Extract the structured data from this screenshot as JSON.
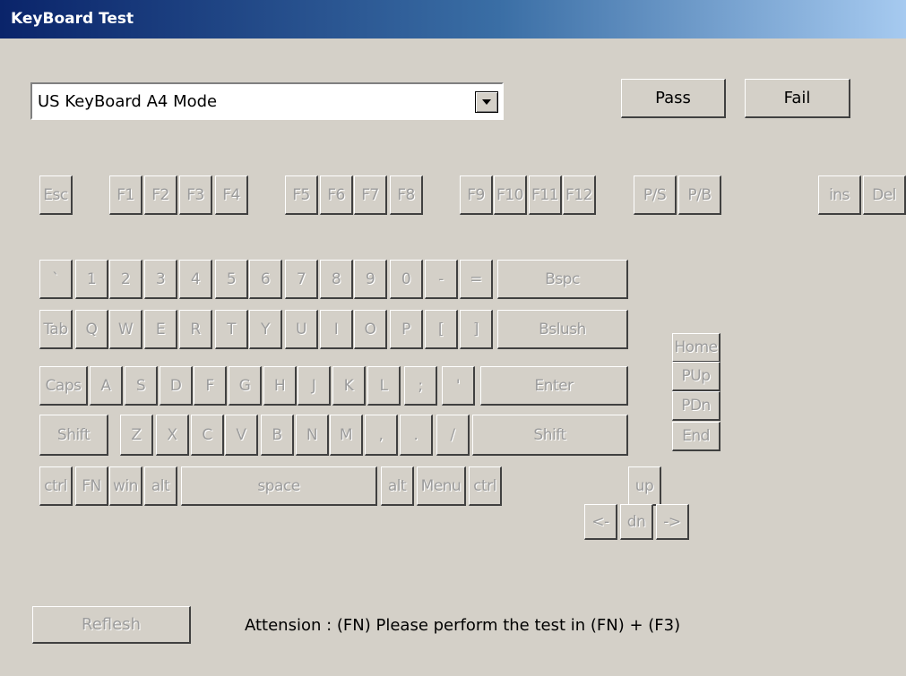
{
  "window": {
    "title": "KeyBoard Test"
  },
  "layout_select": {
    "value": "US KeyBoard A4 Mode"
  },
  "buttons": {
    "pass": "Pass",
    "fail": "Fail",
    "refresh": "Reflesh"
  },
  "attention": "Attension : (FN) Please perform the test in (FN) + (F3)",
  "keys": [
    {
      "id": "esc",
      "label": "Esc"
    },
    {
      "id": "f1",
      "label": "F1"
    },
    {
      "id": "f2",
      "label": "F2"
    },
    {
      "id": "f3",
      "label": "F3"
    },
    {
      "id": "f4",
      "label": "F4"
    },
    {
      "id": "f5",
      "label": "F5"
    },
    {
      "id": "f6",
      "label": "F6"
    },
    {
      "id": "f7",
      "label": "F7"
    },
    {
      "id": "f8",
      "label": "F8"
    },
    {
      "id": "f9",
      "label": "F9"
    },
    {
      "id": "f10",
      "label": "F10"
    },
    {
      "id": "f11",
      "label": "F11"
    },
    {
      "id": "f12",
      "label": "F12"
    },
    {
      "id": "ps",
      "label": "P/S"
    },
    {
      "id": "pb",
      "label": "P/B"
    },
    {
      "id": "ins",
      "label": "ins"
    },
    {
      "id": "del",
      "label": "Del"
    },
    {
      "id": "backtick",
      "label": "`"
    },
    {
      "id": "1",
      "label": "1"
    },
    {
      "id": "2",
      "label": "2"
    },
    {
      "id": "3",
      "label": "3"
    },
    {
      "id": "4",
      "label": "4"
    },
    {
      "id": "5",
      "label": "5"
    },
    {
      "id": "6",
      "label": "6"
    },
    {
      "id": "7",
      "label": "7"
    },
    {
      "id": "8",
      "label": "8"
    },
    {
      "id": "9",
      "label": "9"
    },
    {
      "id": "0",
      "label": "0"
    },
    {
      "id": "minus",
      "label": "-"
    },
    {
      "id": "equal",
      "label": "="
    },
    {
      "id": "bspc",
      "label": "Bspc"
    },
    {
      "id": "tab",
      "label": "Tab"
    },
    {
      "id": "q",
      "label": "Q"
    },
    {
      "id": "w",
      "label": "W"
    },
    {
      "id": "e",
      "label": "E"
    },
    {
      "id": "r",
      "label": "R"
    },
    {
      "id": "t",
      "label": "T"
    },
    {
      "id": "y",
      "label": "Y"
    },
    {
      "id": "u",
      "label": "U"
    },
    {
      "id": "i",
      "label": "I"
    },
    {
      "id": "o",
      "label": "O"
    },
    {
      "id": "p",
      "label": "P"
    },
    {
      "id": "lbracket",
      "label": "["
    },
    {
      "id": "rbracket",
      "label": "]"
    },
    {
      "id": "bslush",
      "label": "Bslush"
    },
    {
      "id": "caps",
      "label": "Caps"
    },
    {
      "id": "a",
      "label": "A"
    },
    {
      "id": "s",
      "label": "S"
    },
    {
      "id": "d",
      "label": "D"
    },
    {
      "id": "f",
      "label": "F"
    },
    {
      "id": "g",
      "label": "G"
    },
    {
      "id": "h",
      "label": "H"
    },
    {
      "id": "j",
      "label": "J"
    },
    {
      "id": "k",
      "label": "K"
    },
    {
      "id": "l",
      "label": "L"
    },
    {
      "id": "semicolon",
      "label": ";"
    },
    {
      "id": "quote",
      "label": "'"
    },
    {
      "id": "enter",
      "label": "Enter"
    },
    {
      "id": "lshift",
      "label": "Shift"
    },
    {
      "id": "z",
      "label": "Z"
    },
    {
      "id": "x",
      "label": "X"
    },
    {
      "id": "c",
      "label": "C"
    },
    {
      "id": "v",
      "label": "V"
    },
    {
      "id": "b",
      "label": "B"
    },
    {
      "id": "n",
      "label": "N"
    },
    {
      "id": "m",
      "label": "M"
    },
    {
      "id": "comma",
      "label": ","
    },
    {
      "id": "period",
      "label": "."
    },
    {
      "id": "slash",
      "label": "/"
    },
    {
      "id": "rshift",
      "label": "Shift"
    },
    {
      "id": "lctrl",
      "label": "ctrl"
    },
    {
      "id": "fn",
      "label": "FN"
    },
    {
      "id": "win",
      "label": "win"
    },
    {
      "id": "lalt",
      "label": "alt"
    },
    {
      "id": "space",
      "label": "space"
    },
    {
      "id": "ralt",
      "label": "alt"
    },
    {
      "id": "menu",
      "label": "Menu"
    },
    {
      "id": "rctrl",
      "label": "ctrl"
    },
    {
      "id": "home",
      "label": "Home"
    },
    {
      "id": "pup",
      "label": "PUp"
    },
    {
      "id": "pdn",
      "label": "PDn"
    },
    {
      "id": "end",
      "label": "End"
    },
    {
      "id": "up",
      "label": "up"
    },
    {
      "id": "left",
      "label": "<-"
    },
    {
      "id": "down",
      "label": "dn"
    },
    {
      "id": "right",
      "label": "->"
    }
  ]
}
